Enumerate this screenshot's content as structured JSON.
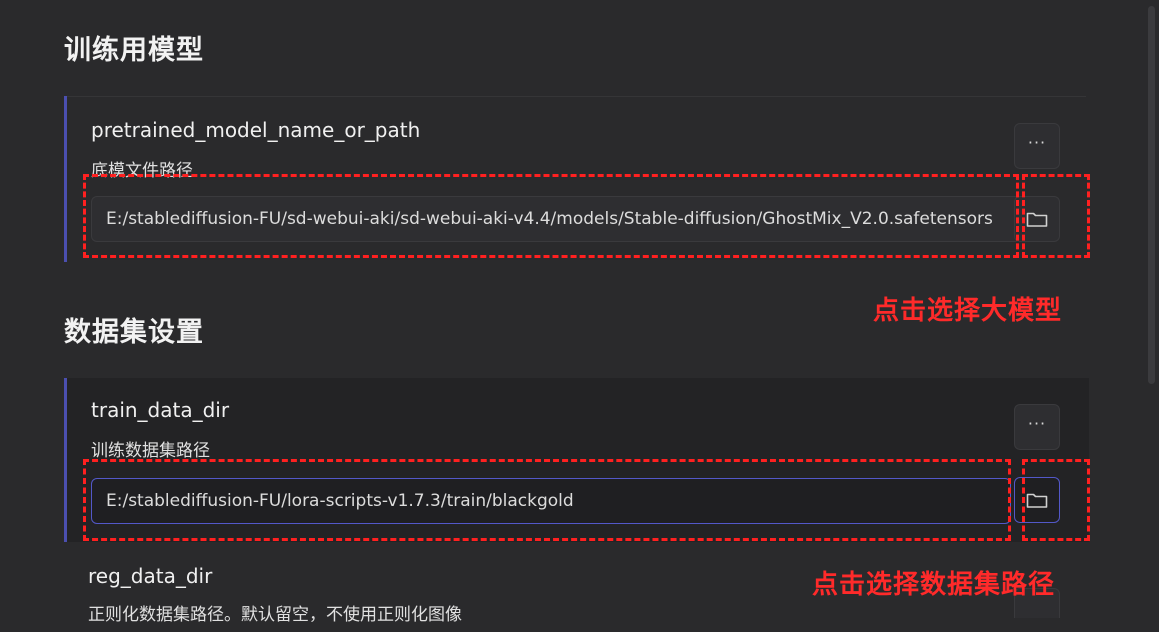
{
  "sections": {
    "model": {
      "title": "训练用模型"
    },
    "dataset": {
      "title": "数据集设置"
    }
  },
  "fields": {
    "pretrained": {
      "name": "pretrained_model_name_or_path",
      "description": "底模文件路径",
      "value": "E:/stablediffusion-FU/sd-webui-aki/sd-webui-aki-v4.4/models/Stable-diffusion/GhostMix_V2.0.safetensors"
    },
    "train_data_dir": {
      "name": "train_data_dir",
      "description": "训练数据集路径",
      "value": "E:/stablediffusion-FU/lora-scripts-v1.7.3/train/blackgold"
    },
    "reg_data_dir": {
      "name": "reg_data_dir",
      "description": "正则化数据集路径。默认留空，不使用正则化图像"
    }
  },
  "buttons": {
    "more_label": "···"
  },
  "annotations": {
    "select_model": "点击选择大模型",
    "select_dataset": "点击选择数据集路径"
  },
  "colors": {
    "background": "#2a2a2c",
    "accent": "#4b4fb0",
    "annotation": "#ff2020"
  },
  "icons": {
    "more": "more-dots-icon",
    "folder": "folder-icon"
  }
}
